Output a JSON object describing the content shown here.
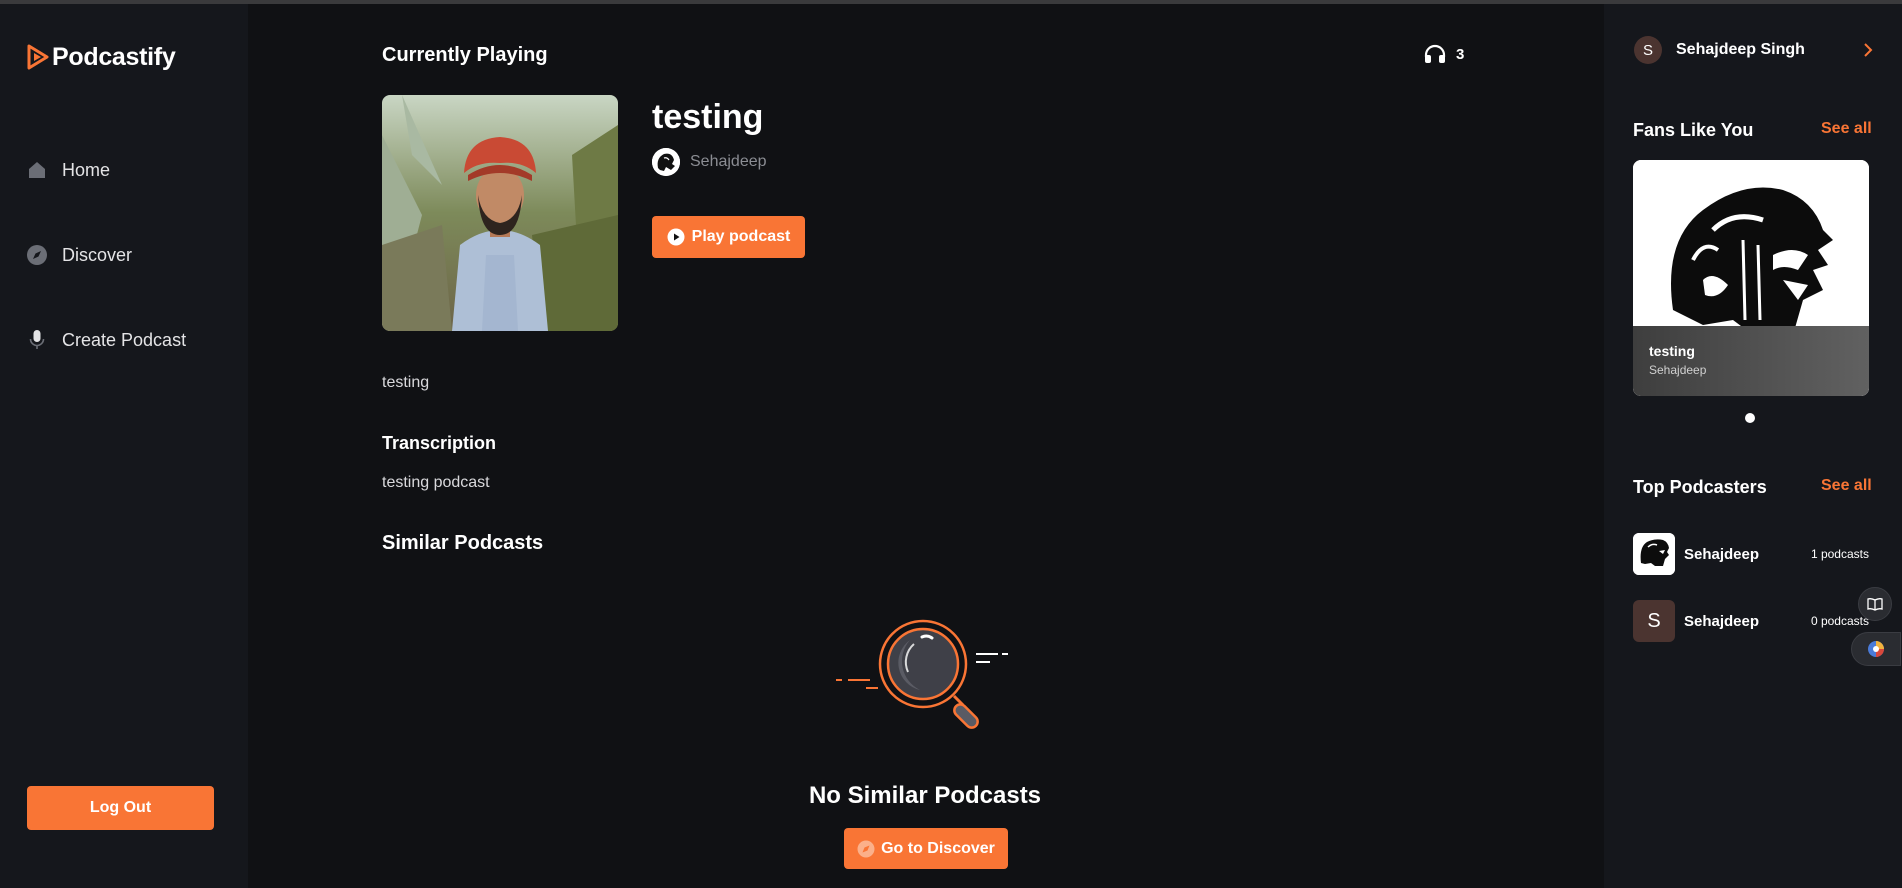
{
  "app": {
    "name": "Podcastify"
  },
  "sidebar": {
    "items": [
      {
        "label": "Home",
        "icon": "home-icon"
      },
      {
        "label": "Discover",
        "icon": "compass-icon"
      },
      {
        "label": "Create Podcast",
        "icon": "microphone-icon"
      }
    ],
    "logout_label": "Log Out"
  },
  "main": {
    "section_title": "Currently Playing",
    "listen_count": "3",
    "podcast": {
      "title": "testing",
      "author": "Sehajdeep",
      "play_label": "Play podcast",
      "description": "testing"
    },
    "transcription": {
      "heading": "Transcription",
      "text": "testing podcast"
    },
    "similar": {
      "heading": "Similar Podcasts",
      "empty_title": "No Similar Podcasts",
      "discover_label": "Go to Discover"
    }
  },
  "rightbar": {
    "user": {
      "initial": "S",
      "name": "Sehajdeep Singh"
    },
    "fans": {
      "heading": "Fans Like You",
      "see_all": "See all",
      "card": {
        "title": "testing",
        "author": "Sehajdeep"
      }
    },
    "top_podcasters": {
      "heading": "Top Podcasters",
      "see_all": "See all",
      "items": [
        {
          "name": "Sehajdeep",
          "count": "1 podcasts",
          "avatar": "lion-logo"
        },
        {
          "name": "Sehajdeep",
          "count": "0 podcasts",
          "avatar": "S"
        }
      ]
    }
  },
  "colors": {
    "accent": "#f97535",
    "background": "#101114",
    "panel": "#15171c"
  }
}
